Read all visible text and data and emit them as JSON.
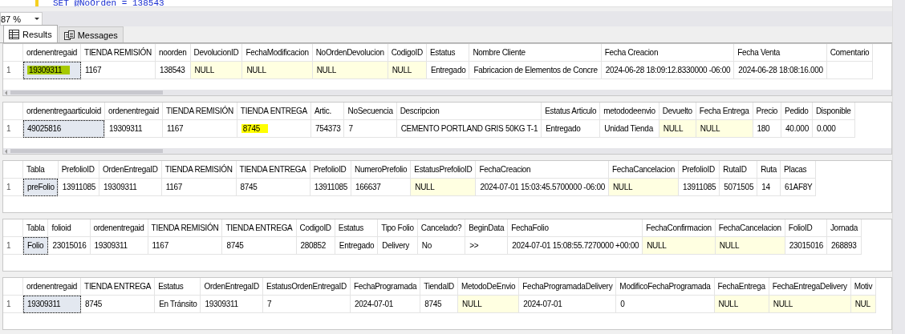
{
  "editor": {
    "code_line": "SET @NoOrden = 138543"
  },
  "zoom": {
    "value": "87 %"
  },
  "tabs": [
    {
      "label": "Results",
      "kind": "grid",
      "selected": true
    },
    {
      "label": "Messages",
      "kind": "messages",
      "selected": false
    }
  ],
  "grids": [
    {
      "scrollbar": true,
      "columns": [
        "ordenentregaid",
        "TIENDA REMISIÓN",
        "noorden",
        "DevolucionID",
        "FechaModificacion",
        "NoOrdenDevolucion",
        "CodigoID",
        "Estatus",
        "Nombre Cliente",
        "Fecha Creacion",
        "Fecha Venta",
        "Comentario"
      ],
      "rows": [
        {
          "number": "1",
          "cells": [
            {
              "text": "19309311",
              "is_null": false,
              "selected": true,
              "color": "#a6c900"
            },
            {
              "text": "1167",
              "is_null": false,
              "selected": false
            },
            {
              "text": "138543",
              "is_null": false,
              "selected": false
            },
            {
              "text": "NULL",
              "is_null": true,
              "selected": false
            },
            {
              "text": "NULL",
              "is_null": true,
              "selected": false
            },
            {
              "text": "NULL",
              "is_null": true,
              "selected": false
            },
            {
              "text": "NULL",
              "is_null": true,
              "selected": false
            },
            {
              "text": "Entregado",
              "is_null": false,
              "selected": false
            },
            {
              "text": "Fabricacion de Elementos de Concre",
              "is_null": false,
              "selected": false
            },
            {
              "text": "2024-06-28 18:09:12.8330000 -06:00",
              "is_null": false,
              "selected": false
            },
            {
              "text": "2024-06-28 18:08:16.000",
              "is_null": false,
              "selected": false
            },
            {
              "text": "",
              "is_null": false,
              "selected": false
            }
          ]
        }
      ]
    },
    {
      "scrollbar": true,
      "columns": [
        "ordenentregaarticuloid",
        "ordenentregaid",
        "TIENDA REMISIÓN",
        "TIENDA ENTREGA",
        "Artic.",
        "NoSecuencia",
        "Descripcion",
        "Estatus Articulo",
        "metododeenvio",
        "Devuelto",
        "Fecha Entrega",
        "Precio",
        "Pedido",
        "Disponible"
      ],
      "rows": [
        {
          "number": "1",
          "cells": [
            {
              "text": "49025816",
              "is_null": false,
              "selected": true
            },
            {
              "text": "19309311",
              "is_null": false,
              "selected": false
            },
            {
              "text": "1167",
              "is_null": false,
              "selected": false
            },
            {
              "text": "8745",
              "is_null": false,
              "selected": false,
              "color": "#ffff00"
            },
            {
              "text": "754373",
              "is_null": false,
              "selected": false
            },
            {
              "text": "7",
              "is_null": false,
              "selected": false
            },
            {
              "text": "CEMENTO PORTLAND GRIS 50KG T-1",
              "is_null": false,
              "selected": false
            },
            {
              "text": "Entregado",
              "is_null": false,
              "selected": false
            },
            {
              "text": "Unidad Tienda",
              "is_null": false,
              "selected": false
            },
            {
              "text": "NULL",
              "is_null": true,
              "selected": false
            },
            {
              "text": "NULL",
              "is_null": true,
              "selected": false
            },
            {
              "text": "180",
              "is_null": false,
              "selected": false
            },
            {
              "text": "40.000",
              "is_null": false,
              "selected": false
            },
            {
              "text": "0.000",
              "is_null": false,
              "selected": false
            }
          ]
        }
      ]
    },
    {
      "scrollbar": false,
      "columns": [
        "Tabla",
        "PrefolioID",
        "OrdenEntregaID",
        "TIENDA REMISIÓN",
        "TIENDA ENTREGA",
        "PrefolioID",
        "NumeroPrefolio",
        "EstatusPrefolioID",
        "FechaCreacion",
        "FechaCancelacion",
        "PrefolioID",
        "RutaID",
        "Ruta",
        "Placas"
      ],
      "rows": [
        {
          "number": "1",
          "cells": [
            {
              "text": "preFolio",
              "is_null": false,
              "selected": true
            },
            {
              "text": "13911085",
              "is_null": false,
              "selected": false
            },
            {
              "text": "19309311",
              "is_null": false,
              "selected": false
            },
            {
              "text": "1167",
              "is_null": false,
              "selected": false
            },
            {
              "text": "8745",
              "is_null": false,
              "selected": false
            },
            {
              "text": "13911085",
              "is_null": false,
              "selected": false
            },
            {
              "text": "166637",
              "is_null": false,
              "selected": false
            },
            {
              "text": "NULL",
              "is_null": true,
              "selected": false
            },
            {
              "text": "2024-07-01 15:03:45.5700000 -06:00",
              "is_null": false,
              "selected": false
            },
            {
              "text": "NULL",
              "is_null": true,
              "selected": false
            },
            {
              "text": "13911085",
              "is_null": false,
              "selected": false
            },
            {
              "text": "5071505",
              "is_null": false,
              "selected": false
            },
            {
              "text": "14",
              "is_null": false,
              "selected": false
            },
            {
              "text": "61AF8Y",
              "is_null": false,
              "selected": false
            }
          ]
        }
      ]
    },
    {
      "scrollbar": false,
      "columns": [
        "Tabla",
        "folioid",
        "ordenentregaid",
        "TIENDA REMISIÓN",
        "TIENDA ENTREGA",
        "CodigoID",
        "Estatus",
        "Tipo Folio",
        "Cancelado?",
        "BeginData",
        "FechaFolio",
        "FechaConfirmacion",
        "FechaCancelacion",
        "FolioID",
        "Jornada"
      ],
      "rows": [
        {
          "number": "1",
          "cells": [
            {
              "text": "Folio",
              "is_null": false,
              "selected": true
            },
            {
              "text": "23015016",
              "is_null": false,
              "selected": false
            },
            {
              "text": "19309311",
              "is_null": false,
              "selected": false
            },
            {
              "text": "1167",
              "is_null": false,
              "selected": false
            },
            {
              "text": "8745",
              "is_null": false,
              "selected": false
            },
            {
              "text": "280852",
              "is_null": false,
              "selected": false
            },
            {
              "text": "Entregado",
              "is_null": false,
              "selected": false
            },
            {
              "text": "Delivery",
              "is_null": false,
              "selected": false
            },
            {
              "text": "No",
              "is_null": false,
              "selected": false
            },
            {
              "text": ">>",
              "is_null": false,
              "selected": false
            },
            {
              "text": "2024-07-01 15:08:55.7270000 +00:00",
              "is_null": false,
              "selected": false
            },
            {
              "text": "NULL",
              "is_null": true,
              "selected": false
            },
            {
              "text": "NULL",
              "is_null": true,
              "selected": false
            },
            {
              "text": "23015016",
              "is_null": false,
              "selected": false
            },
            {
              "text": "268893",
              "is_null": false,
              "selected": false
            }
          ]
        }
      ]
    },
    {
      "scrollbar": false,
      "columns": [
        "ordenentregaid",
        "TIENDA ENTREGA",
        "Estatus",
        "OrdenEntregaID",
        "EstatusOrdenEntregaID",
        "FechaProgramada",
        "TiendaID",
        "MetodoDeEnvio",
        "FechaProgramadaDelivery",
        "ModificoFechaProgramada",
        "FechaEntrega",
        "FechaEntregaDelivery",
        "Motiv"
      ],
      "rows": [
        {
          "number": "1",
          "cells": [
            {
              "text": "19309311",
              "is_null": false,
              "selected": true
            },
            {
              "text": "8745",
              "is_null": false,
              "selected": false
            },
            {
              "text": "En Tránsito",
              "is_null": false,
              "selected": false
            },
            {
              "text": "19309311",
              "is_null": false,
              "selected": false
            },
            {
              "text": "7",
              "is_null": false,
              "selected": false
            },
            {
              "text": "2024-07-01",
              "is_null": false,
              "selected": false
            },
            {
              "text": "8745",
              "is_null": false,
              "selected": false
            },
            {
              "text": "NULL",
              "is_null": true,
              "selected": false
            },
            {
              "text": "2024-07-01",
              "is_null": false,
              "selected": false
            },
            {
              "text": "0",
              "is_null": false,
              "selected": false
            },
            {
              "text": "NULL",
              "is_null": true,
              "selected": false
            },
            {
              "text": "NULL",
              "is_null": true,
              "selected": false
            },
            {
              "text": "NUL",
              "is_null": true,
              "selected": false
            }
          ]
        }
      ]
    }
  ]
}
